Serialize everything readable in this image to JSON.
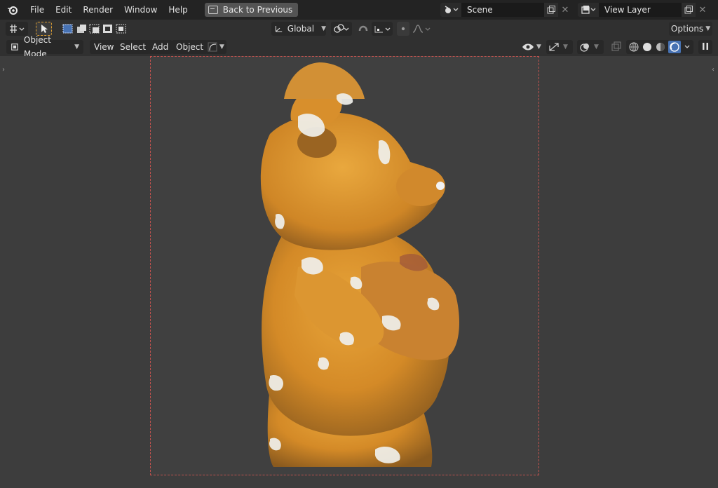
{
  "menubar": {
    "logo_icon": "blender-logo-icon",
    "items": [
      "File",
      "Edit",
      "Render",
      "Window",
      "Help"
    ],
    "back_label": "Back to Previous"
  },
  "scene": {
    "name": "Scene"
  },
  "view_layer": {
    "name": "View Layer"
  },
  "toolbar": {
    "transform_orientation": "Global",
    "options_label": "Options"
  },
  "header": {
    "mode": "Object Mode",
    "view": "View",
    "select": "Select",
    "add": "Add",
    "object": "Object"
  },
  "colors": {
    "accent_blue": "#4772b3",
    "frame_border": "#c0524e",
    "active_tool": "#e0a030"
  }
}
